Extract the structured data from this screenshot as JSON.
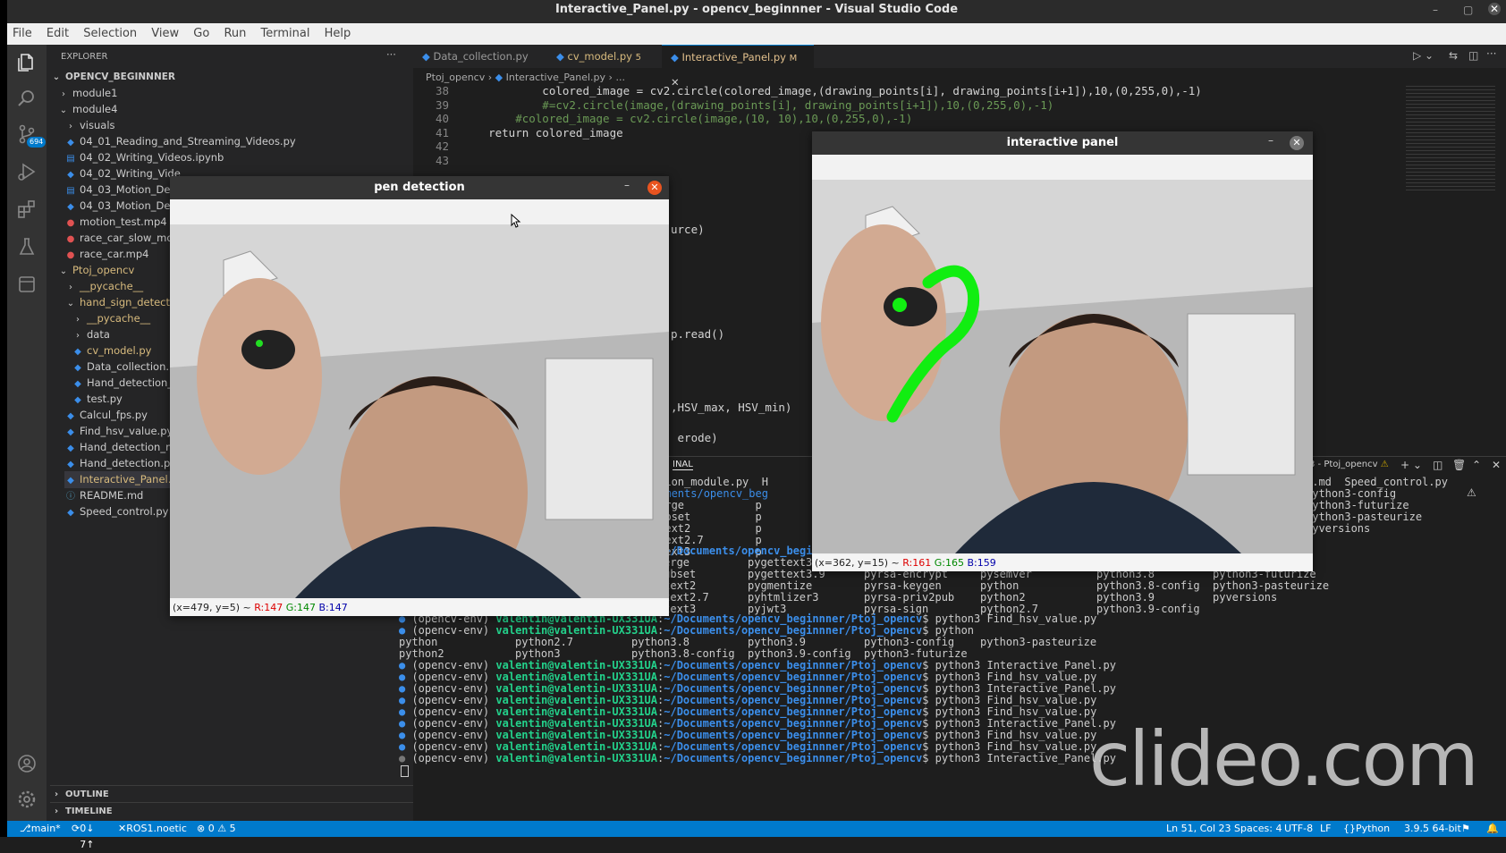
{
  "window": {
    "title": "Interactive_Panel.py - opencv_beginnner - Visual Studio Code"
  },
  "menu": [
    "File",
    "Edit",
    "Selection",
    "View",
    "Go",
    "Run",
    "Terminal",
    "Help"
  ],
  "activity_bar": {
    "source_control_badge": "694"
  },
  "explorer": {
    "title": "EXPLORER",
    "root": "OPENCV_BEGINNNER",
    "items": [
      {
        "label": "module1",
        "kind": "folder-collapsed"
      },
      {
        "label": "module4",
        "kind": "folder-open"
      },
      {
        "label": "visuals",
        "kind": "folder-collapsed"
      },
      {
        "label": "04_01_Reading_and_Streaming_Videos.py",
        "kind": "py"
      },
      {
        "label": "04_02_Writing_Videos.ipynb",
        "kind": "ipynb"
      },
      {
        "label": "04_02_Writing_Vide",
        "kind": "py"
      },
      {
        "label": "04_03_Motion_Dete",
        "kind": "ipynb"
      },
      {
        "label": "04_03_Motion_Dete",
        "kind": "py"
      },
      {
        "label": "motion_test.mp4",
        "kind": "mp4"
      },
      {
        "label": "race_car_slow_moti",
        "kind": "mp4"
      },
      {
        "label": "race_car.mp4",
        "kind": "mp4"
      },
      {
        "label": "Ptoj_opencv",
        "kind": "folder-open-mod"
      },
      {
        "label": "__pycache__",
        "kind": "folder-collapsed-mod"
      },
      {
        "label": "hand_sign_detectio",
        "kind": "folder-open-mod"
      },
      {
        "label": "__pycache__",
        "kind": "folder-collapsed-mod"
      },
      {
        "label": "data",
        "kind": "folder-collapsed"
      },
      {
        "label": "cv_model.py",
        "kind": "py-mod"
      },
      {
        "label": "Data_collection.py",
        "kind": "py"
      },
      {
        "label": "Hand_detection_m",
        "kind": "py"
      },
      {
        "label": "test.py",
        "kind": "py"
      },
      {
        "label": "Calcul_fps.py",
        "kind": "py"
      },
      {
        "label": "Find_hsv_value.py",
        "kind": "py"
      },
      {
        "label": "Hand_detection_mo",
        "kind": "py"
      },
      {
        "label": "Hand_detection.py",
        "kind": "py"
      },
      {
        "label": "Interactive_Panel.py",
        "kind": "py-active"
      },
      {
        "label": "README.md",
        "kind": "md"
      },
      {
        "label": "Speed_control.py",
        "kind": "py"
      }
    ],
    "outline": "OUTLINE",
    "timeline": "TIMELINE"
  },
  "tabs": [
    {
      "label": "Data_collection.py",
      "badge": ""
    },
    {
      "label": "cv_model.py",
      "badge": "5"
    },
    {
      "label": "Interactive_Panel.py",
      "badge": "M"
    }
  ],
  "breadcrumb": [
    "Ptoj_opencv",
    "Interactive_Panel.py",
    "..."
  ],
  "code": {
    "lines": [
      {
        "n": "38",
        "text": "            colored_image = cv2.circle(colored_image,(drawing_points[i], drawing_points[i+1]),10,(0,255,0),-1)"
      },
      {
        "n": "39",
        "text": "            #=cv2.circle(image,(drawing_points[i], drawing_points[i+1]),10,(0,255,0),-1)"
      },
      {
        "n": "40",
        "text": "        #colored_image = cv2.circle(image,(10, 10),10,(0,255,0),-1)"
      },
      {
        "n": "41",
        "text": "    return colored_image"
      },
      {
        "n": "42",
        "text": ""
      },
      {
        "n": "43",
        "text": ""
      }
    ],
    "fragments": [
      "urce)",
      "p.read()",
      ",HSV_max, HSV_min)",
      " erode)"
    ]
  },
  "terminal": {
    "panel_label": "INAL",
    "right_header": "3 - Ptoj_opencv",
    "top_right_lines": [
      "s.md  Speed_control.py",
      "python3-config",
      "python3-futurize",
      "python3-pasteurize",
      "pyversions"
    ],
    "top_lines": [
      "detection_module.py  H",
      "~/Documents/opencv_beg",
      "pyftmerge           p",
      "pyftsubset          p",
      "pygettext2          p",
      "pygettext2.7        p",
      "pygettext3          p"
    ],
    "prompt_user": "valentin@valentin-UX331UA",
    "prompt_path": "~/Documents/opencv_beginnner/Ptoj_opencv",
    "env": "(opencv-env)",
    "py_line": "$ py",
    "completion_rows": [
      [
        "pyftmerge",
        "pygettext3.8",
        "pyrsa-decrypt",
        "pyrsa-verify",
        "python3",
        "python3-config"
      ],
      [
        "pyftsubset",
        "pygettext3.9",
        "pyrsa-encrypt",
        "pysemver",
        "python3.8",
        "python3-futurize"
      ],
      [
        "pygettext2",
        "pygmentize",
        "pyrsa-keygen",
        "python",
        "python3.8-config",
        "python3-pasteurize"
      ],
      [
        "pygettext2.7",
        "pyhtmlizer3",
        "pyrsa-priv2pub",
        "python2",
        "python3.9",
        "pyversions"
      ],
      [
        "pygettext3",
        "pyjwt3",
        "pyrsa-sign",
        "python2.7",
        "python3.9-config",
        ""
      ]
    ],
    "left_rows": [
      [
        "pyclean",
        "pydoc3.8"
      ],
      [
        "pycompile",
        "pydoc3.9"
      ]
    ],
    "commands": [
      "$ python3 Find_hsv_value.py",
      "$ python"
    ],
    "python_rows": [
      [
        "python",
        "python2.7",
        "python3.8",
        "python3.9",
        "python3-config",
        "python3-pasteurize"
      ],
      [
        "python2",
        "python3",
        "python3.8-config",
        "python3.9-config",
        "python3-futurize",
        ""
      ]
    ],
    "history": [
      "$ python3 Interactive_Panel.py",
      "$ python3 Find_hsv_value.py",
      "$ python3 Interactive_Panel.py",
      "$ python3 Find_hsv_value.py",
      "$ python3 Find_hsv_value.py",
      "$ python3 Interactive_Panel.py",
      "$ python3 Find_hsv_value.py",
      "$ python3 Find_hsv_value.py",
      "$ python3 Interactive_Panel.py"
    ]
  },
  "pen_window": {
    "title": "pen detection",
    "coords": "(x=479, y=5) ~",
    "r": "R:147",
    "g": "G:147",
    "b": "B:147"
  },
  "panel_window": {
    "title": "interactive panel",
    "coords": "(x=362, y=15) ~",
    "r": "R:161",
    "g": "G:165",
    "b": "B:159"
  },
  "statusbar": {
    "branch": "main*",
    "sync": "0↓ 7↑",
    "remote": "ROS1.noetic",
    "problems": "⊗ 0 ⚠ 5",
    "position": "Ln 51, Col 23",
    "spaces": "Spaces: 4",
    "encoding": "UTF-8",
    "eol": "LF",
    "language": "Python",
    "interpreter": "3.9.5 64-bit"
  },
  "watermark": "clideo.com"
}
